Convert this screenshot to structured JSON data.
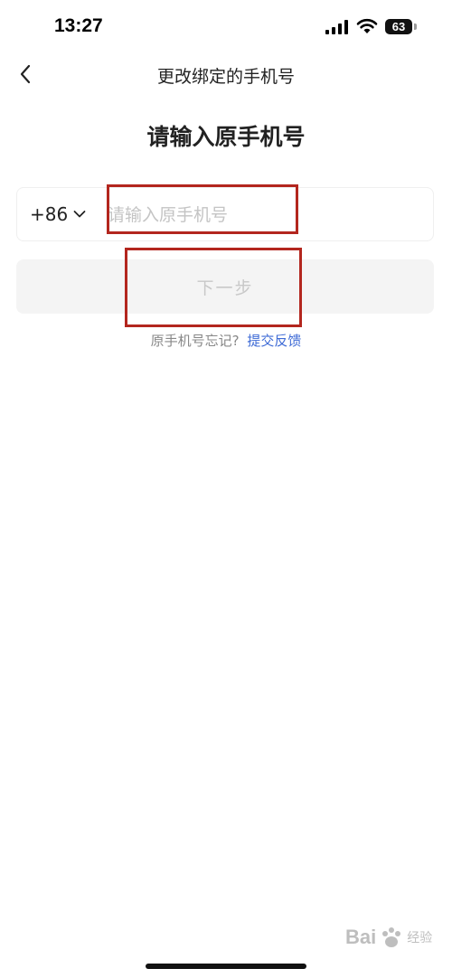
{
  "status_bar": {
    "time": "13:27",
    "battery": "63",
    "icons": [
      "signal-icon",
      "wifi-icon",
      "battery-icon"
    ]
  },
  "nav": {
    "title": "更改绑定的手机号",
    "back_icon": "chevron-left-icon"
  },
  "page": {
    "title": "请输入原手机号"
  },
  "form": {
    "country_code": "+86",
    "country_code_icon": "chevron-down-icon",
    "phone_value": "",
    "phone_placeholder": "请输入原手机号",
    "next_label": "下一步"
  },
  "footer": {
    "forgot_text": "原手机号忘记?",
    "feedback_link": "提交反馈"
  },
  "watermark": {
    "brand": "Bai",
    "sub": "经验"
  },
  "colors": {
    "highlight": "#b3261e",
    "link": "#3d6ad6",
    "disabled_button_bg": "#f4f4f4",
    "disabled_button_text": "#c8c8c8"
  }
}
